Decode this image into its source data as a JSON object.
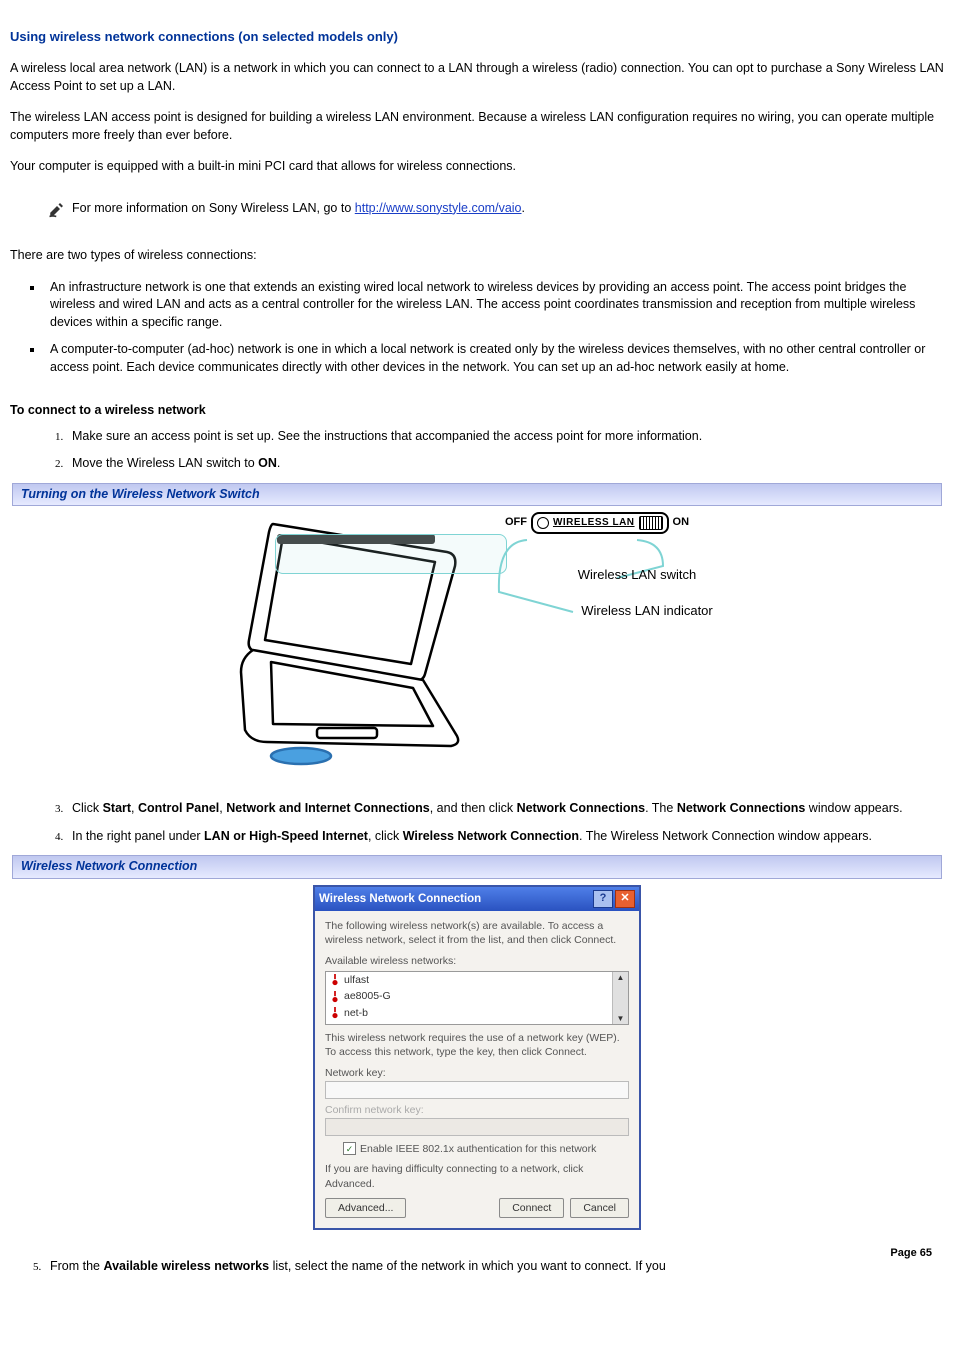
{
  "title": "Using wireless network connections (on selected models only)",
  "p1": "A wireless local area network (LAN) is a network in which you can connect to a LAN through a wireless (radio) connection. You can opt to purchase a Sony Wireless LAN Access Point to set up a LAN.",
  "p2": "The wireless LAN access point is designed for building a wireless LAN environment. Because a wireless LAN configuration requires no wiring, you can operate multiple computers more freely than ever before.",
  "p3": "Your computer is equipped with a built-in mini PCI card that allows for wireless connections.",
  "note_prefix": "For more information on Sony Wireless LAN, go to ",
  "note_link": "http://www.sonystyle.com/vaio",
  "p4": "There are two types of wireless connections:",
  "bullets": [
    "An infrastructure network is one that extends an existing wired local network to wireless devices by providing an access point. The access point bridges the wireless and wired LAN and acts as a central controller for the wireless LAN. The access point coordinates transmission and reception from multiple wireless devices within a specific range.",
    "A computer-to-computer (ad-hoc) network is one in which a local network is created only by the wireless devices themselves, with no other central controller or access point. Each device communicates directly with other devices in the network. You can set up an ad-hoc network easily at home."
  ],
  "connect_head": "To connect to a wireless network",
  "steps12": [
    "Make sure an access point is set up. See the instructions that accompanied the access point for more information.",
    "Move the Wireless LAN switch to "
  ],
  "on_label": "ON",
  "fig1_title": "Turning on the Wireless Network Switch",
  "switch": {
    "off": "OFF",
    "on": "ON",
    "label": "WIRELESS LAN"
  },
  "callout1": "Wireless LAN switch",
  "callout2": "Wireless LAN indicator",
  "step3": {
    "prefix": "Click ",
    "b1": "Start",
    "s1": ", ",
    "b2": "Control Panel",
    "s2": ", ",
    "b3": "Network and Internet Connections",
    "s3": ", and then click ",
    "b4": "Network Connections",
    "s4": ". The ",
    "b5": "Network Connections",
    "s5": " window appears."
  },
  "step4": {
    "prefix": "In the right panel under ",
    "b1": "LAN or High-Speed Internet",
    "s1": ", click ",
    "b2": "Wireless Network Connection",
    "s2": ". The Wireless Network Connection window appears."
  },
  "fig2_title": "Wireless Network Connection",
  "dialog": {
    "title": "Wireless Network Connection",
    "intro": "The following wireless network(s) are available. To access a wireless network, select it from the list, and then click Connect.",
    "avail_label": "Available wireless networks:",
    "networks": [
      "ulfast",
      "ae8005-G",
      "net-b"
    ],
    "wep_msg": "This wireless network requires the use of a network key (WEP). To access this network, type the key, then click Connect.",
    "key_label": "Network key:",
    "confirm_label": "Confirm network key:",
    "checkbox": "Enable IEEE 802.1x authentication for this network",
    "help_msg": "If you are having difficulty connecting to a network, click Advanced.",
    "advanced": "Advanced...",
    "connect": "Connect",
    "cancel": "Cancel"
  },
  "step5": {
    "prefix": "From the ",
    "b1": "Available wireless networks",
    "suffix": " list, select the name of the network in which you want to connect. If you"
  },
  "page_number": "Page 65"
}
